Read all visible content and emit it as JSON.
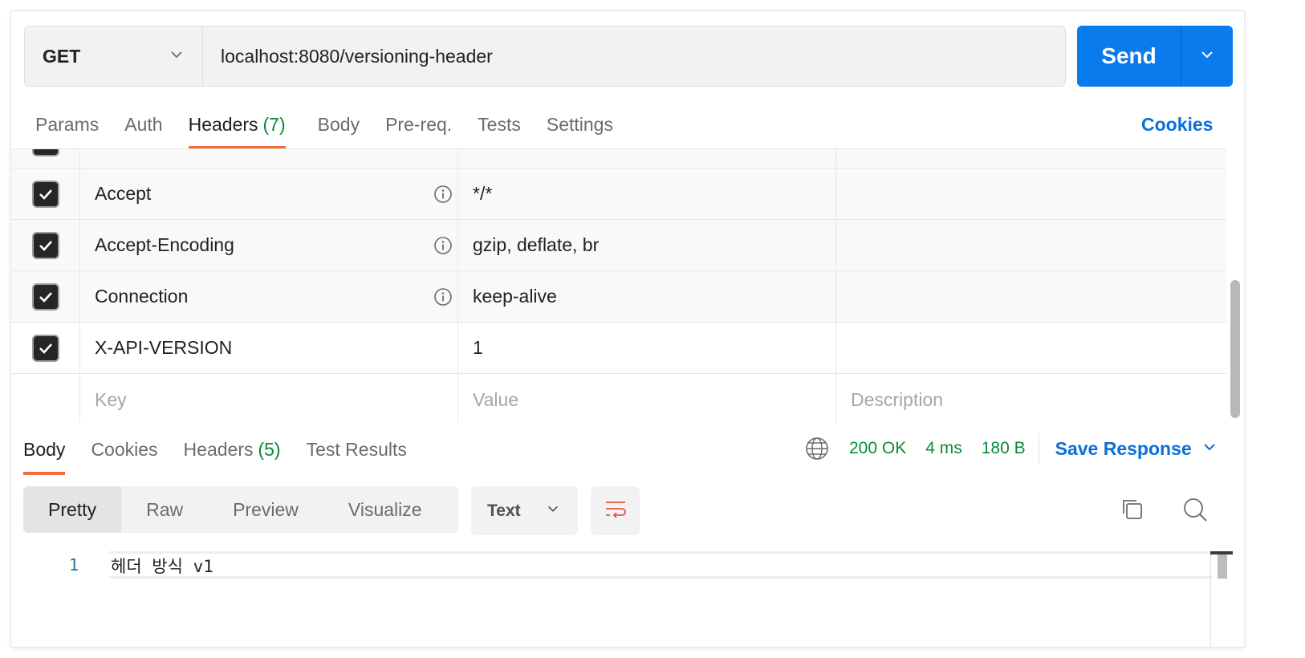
{
  "request": {
    "method": "GET",
    "url": "localhost:8080/versioning-header",
    "send_label": "Send"
  },
  "request_tabs": [
    {
      "label": "Params"
    },
    {
      "label": "Auth"
    },
    {
      "label": "Headers",
      "count": "(7)"
    },
    {
      "label": "Body"
    },
    {
      "label": "Pre-req."
    },
    {
      "label": "Tests"
    },
    {
      "label": "Settings"
    }
  ],
  "cookies_label": "Cookies",
  "headers": [
    {
      "key": "Accept",
      "value": "*/*",
      "checked": true
    },
    {
      "key": "Accept-Encoding",
      "value": "gzip, deflate, br",
      "checked": true
    },
    {
      "key": "Connection",
      "value": "keep-alive",
      "checked": true
    },
    {
      "key": "X-API-VERSION",
      "value": "1",
      "checked": true
    }
  ],
  "new_row": {
    "key_placeholder": "Key",
    "value_placeholder": "Value",
    "description_placeholder": "Description"
  },
  "response_tabs": [
    {
      "label": "Body"
    },
    {
      "label": "Cookies"
    },
    {
      "label": "Headers",
      "count": "(5)"
    },
    {
      "label": "Test Results"
    }
  ],
  "status": {
    "code": "200 OK",
    "time": "4 ms",
    "size": "180 B"
  },
  "save_response_label": "Save Response",
  "view_modes": [
    "Pretty",
    "Raw",
    "Preview",
    "Visualize"
  ],
  "format": "Text",
  "code": {
    "line_number": "1",
    "text": "헤더 방식 v1"
  },
  "colors": {
    "accent_send": "#097bed",
    "active_tab": "#f26b3a",
    "success": "#0b8a35",
    "link": "#0b6ed8"
  }
}
